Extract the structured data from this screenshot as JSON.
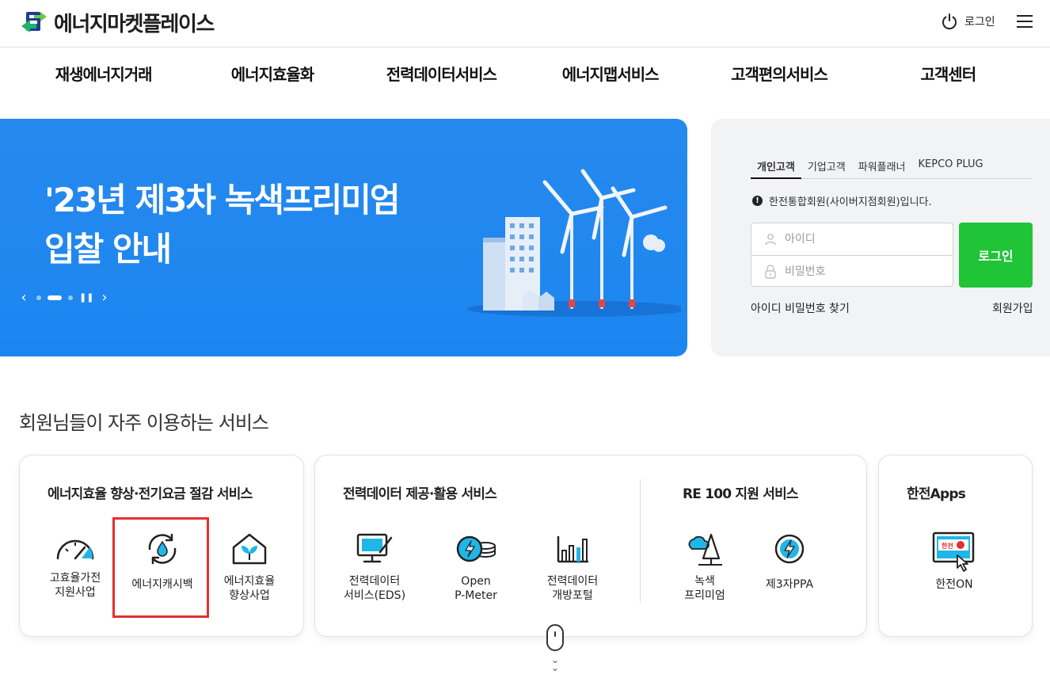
{
  "header": {
    "logo_text": "에너지마켓플레이스",
    "login_label": "로그인"
  },
  "nav": [
    {
      "label": "재생에너지거래"
    },
    {
      "label": "에너지효율화"
    },
    {
      "label": "전력데이터서비스"
    },
    {
      "label": "에너지맵서비스"
    },
    {
      "label": "고객편의서비스"
    },
    {
      "label": "고객센터"
    }
  ],
  "banner": {
    "title": "'23년 제3차 녹색프리미엄\n입찰 안내",
    "slides_total": 3,
    "active_slide": 2
  },
  "login_box": {
    "tabs": [
      "개인고객",
      "기업고객",
      "파워플래너",
      "KEPCO PLUG"
    ],
    "active_tab": "개인고객",
    "notice": "한전통합회원(사이버지점회원)입니다.",
    "id_placeholder": "아이디",
    "pw_placeholder": "비밀번호",
    "login_button": "로그인",
    "find_link": "아이디 비밀번호 찾기",
    "join_link": "회원가입"
  },
  "services": {
    "section_title": "회원님들이 자주 이용하는 서비스",
    "cards": [
      {
        "title": "에너지효율 향상·전기요금 절감 서비스",
        "items": [
          {
            "label": "고효율가전\n지원사업",
            "icon": "gauge-icon"
          },
          {
            "label": "에너지캐시백",
            "icon": "water-refresh-icon"
          },
          {
            "label": "에너지효율\n향상사업",
            "icon": "leaf-house-icon"
          }
        ]
      },
      {
        "title": "전력데이터 제공·활용 서비스",
        "items": [
          {
            "label": "전력데이터\n서비스(EDS)",
            "icon": "monitor-icon"
          },
          {
            "label": "Open\nP-Meter",
            "icon": "meter-icon"
          },
          {
            "label": "전력데이터\n개방포털",
            "icon": "bar-chart-icon"
          }
        ]
      },
      {
        "title": "RE 100 지원 서비스",
        "items": [
          {
            "label": "녹색\n프리미엄",
            "icon": "cloud-tree-icon"
          },
          {
            "label": "제3자PPA",
            "icon": "bolt-circle-icon"
          }
        ]
      },
      {
        "title": "한전Apps",
        "items": [
          {
            "label": "한전ON",
            "icon": "kepco-on-icon"
          }
        ]
      }
    ]
  },
  "colors": {
    "banner_blue": "#1c86f0",
    "login_green": "#20c437",
    "highlight_red": "#e53030",
    "icon_cyan": "#1fb6e8"
  }
}
